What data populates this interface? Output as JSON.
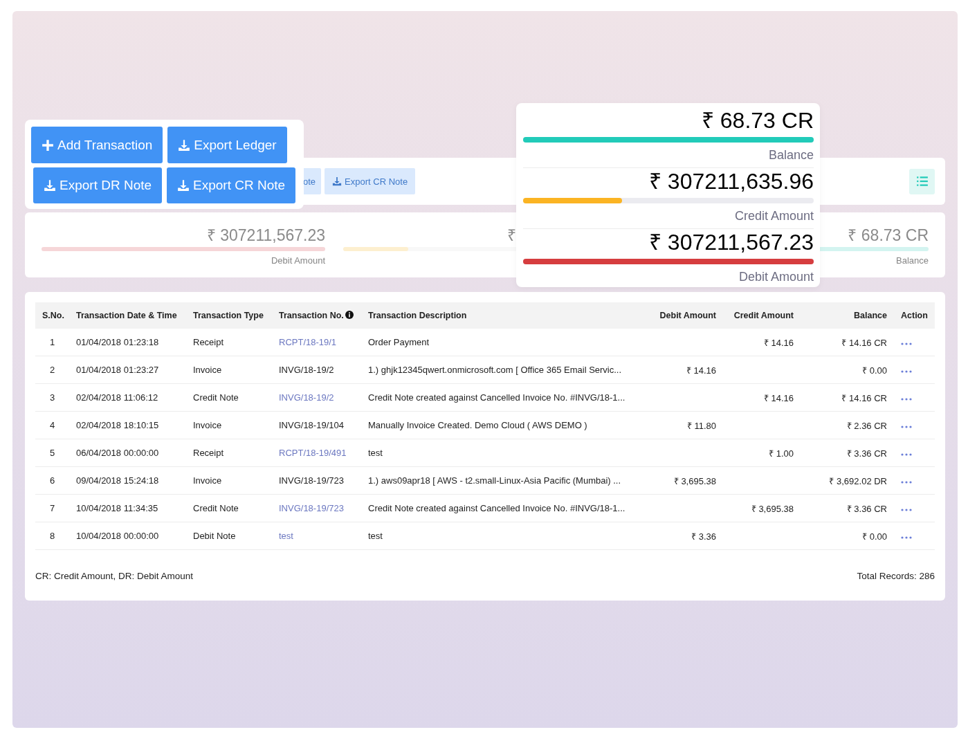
{
  "toolbar": {
    "buttons": [
      {
        "label": "ote",
        "kind": "text"
      },
      {
        "label": "Export CR Note",
        "kind": "download"
      }
    ]
  },
  "summary": [
    {
      "amount": "₹ 307211,567.23",
      "level": 1,
      "label": "Debit Amount",
      "color": "#f6d6d8"
    },
    {
      "amount": "₹",
      "level": 0.23,
      "color": "#fdefcf"
    },
    {
      "amount": "₹ 68.73 CR",
      "level": 1,
      "label": "Balance",
      "color": "#d3f4f0"
    }
  ],
  "action_menu": {
    "buttons": [
      {
        "label": "Add Transaction",
        "kind": "plus"
      },
      {
        "label": "Export Ledger",
        "kind": "download"
      },
      {
        "label": "Export DR Note",
        "kind": "download"
      },
      {
        "label": "Export CR Note",
        "kind": "download"
      }
    ]
  },
  "totals_popup": {
    "items": [
      {
        "amount": "₹ 68.73 CR",
        "level": 1,
        "label": "Balance",
        "color": "#22cbb9"
      },
      {
        "amount": "₹ 307211,635.96",
        "level": 0.34,
        "label": "Credit Amount",
        "color": "#fbb423"
      },
      {
        "amount": "₹ 307211,567.23",
        "level": 1,
        "label": "Debit Amount",
        "color": "#d63d3f"
      }
    ]
  },
  "table": {
    "columns": [
      "S.No.",
      "Transaction Date & Time",
      "Transaction Type",
      "Transaction No.",
      "Transaction Description",
      "Debit Amount",
      "Credit Amount",
      "Balance",
      "Action"
    ],
    "rows": [
      {
        "sno": "1",
        "date": "01/04/2018 01:23:18",
        "type": "Receipt",
        "number": "RCPT/18-19/1",
        "linked": true,
        "description": "Order Payment",
        "debit": "",
        "credit": "₹ 14.16",
        "balance": "₹ 14.16 CR"
      },
      {
        "sno": "2",
        "date": "01/04/2018 01:23:27",
        "type": "Invoice",
        "number": "INVG/18-19/2",
        "linked": false,
        "description": "1.) ghjk12345qwert.onmicrosoft.com [ Office 365 Email Servic...",
        "debit": "₹ 14.16",
        "credit": "",
        "balance": "₹ 0.00"
      },
      {
        "sno": "3",
        "date": "02/04/2018 11:06:12",
        "type": "Credit Note",
        "number": "INVG/18-19/2",
        "linked": true,
        "description": "Credit Note created against Cancelled Invoice No. #INVG/18-1...",
        "debit": "",
        "credit": "₹ 14.16",
        "balance": "₹ 14.16 CR"
      },
      {
        "sno": "4",
        "date": "02/04/2018 18:10:15",
        "type": "Invoice",
        "number": "INVG/18-19/104",
        "linked": false,
        "description": "Manually Invoice Created. Demo Cloud ( AWS DEMO )",
        "debit": "₹ 11.80",
        "credit": "",
        "balance": "₹ 2.36 CR"
      },
      {
        "sno": "5",
        "date": "06/04/2018 00:00:00",
        "type": "Receipt",
        "number": "RCPT/18-19/491",
        "linked": true,
        "description": "test",
        "debit": "",
        "credit": "₹ 1.00",
        "balance": "₹ 3.36 CR"
      },
      {
        "sno": "6",
        "date": "09/04/2018 15:24:18",
        "type": "Invoice",
        "number": "INVG/18-19/723",
        "linked": false,
        "description": "1.) aws09apr18 [ AWS - t2.small-Linux-Asia Pacific (Mumbai) ...",
        "debit": "₹ 3,695.38",
        "credit": "",
        "balance": "₹ 3,692.02 DR"
      },
      {
        "sno": "7",
        "date": "10/04/2018 11:34:35",
        "type": "Credit Note",
        "number": "INVG/18-19/723",
        "linked": true,
        "description": "Credit Note created against Cancelled Invoice No. #INVG/18-1...",
        "debit": "",
        "credit": "₹ 3,695.38",
        "balance": "₹ 3.36 CR"
      },
      {
        "sno": "8",
        "date": "10/04/2018 00:00:00",
        "type": "Debit Note",
        "number": "test",
        "linked": true,
        "description": "test",
        "debit": "₹ 3.36",
        "credit": "",
        "balance": "₹ 0.00"
      }
    ]
  },
  "footer": {
    "legend": "CR: Credit Amount, DR: Debit Amount",
    "total": "Total Records: 286"
  }
}
